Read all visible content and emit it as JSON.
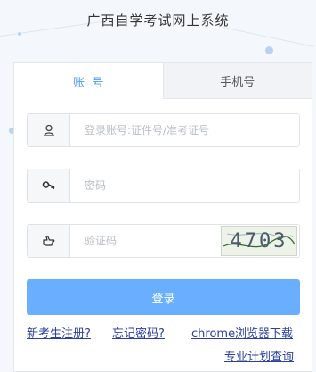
{
  "page": {
    "title": "广西自学考试网上系统"
  },
  "tabs": [
    {
      "label": "账  号"
    },
    {
      "label": "手机号"
    }
  ],
  "fields": {
    "account": {
      "placeholder": "登录账号:证件号/准考证号",
      "icon": "user-icon"
    },
    "password": {
      "placeholder": "密码",
      "icon": "key-icon"
    },
    "captcha": {
      "placeholder": "验证码",
      "icon": "hand-pointing-icon",
      "code": "4703"
    }
  },
  "login_button": {
    "label": "登录"
  },
  "links": {
    "register": "新考生注册?",
    "forgot": "忘记密码?",
    "chrome": "chrome浏览器下载",
    "plan": "专业计划查询"
  },
  "colors": {
    "accent": "#4a9af5",
    "button": "#6aafff",
    "link": "#2b3f9e"
  }
}
